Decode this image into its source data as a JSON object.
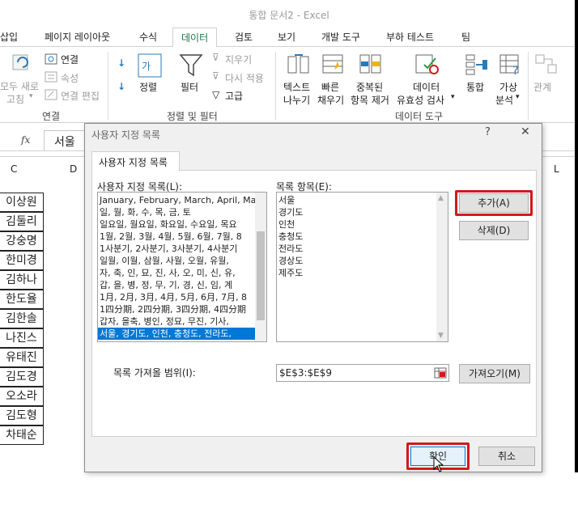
{
  "window": {
    "title": "통합 문서2 - Excel"
  },
  "tabs": [
    "삽입",
    "페이지 레이아웃",
    "수식",
    "데이터",
    "검토",
    "보기",
    "개발 도구",
    "부하 테스트",
    "팀"
  ],
  "ribbon": {
    "conn_refresh_1": "모두 새로",
    "conn_refresh_2": "고침",
    "conn_connect": "연결",
    "conn_props": "속성",
    "conn_edit": "연결 편집",
    "group_connections": "연결",
    "sort_label": "정렬",
    "filter_label": "필터",
    "clear": "지우기",
    "reapply": "다시 적용",
    "advanced": "고급",
    "group_sortfilter": "정렬 및 필터",
    "text_to_col_1": "텍스트",
    "text_to_col_2": "나누기",
    "flash_1": "빠른",
    "flash_2": "채우기",
    "remove_dup_1": "중복된",
    "remove_dup_2": "항목 제거",
    "validate_1": "데이터",
    "validate_2": "유효성 검사",
    "consolidate": "통합",
    "whatif_1": "가상",
    "whatif_2": "분석",
    "relations": "관계",
    "group_datatools": "데이터 도구"
  },
  "formula_bar": {
    "fx": "fx",
    "value": "서울"
  },
  "columns": {
    "c": "C",
    "d": "D",
    "l": "L"
  },
  "cells": [
    "이상원",
    "김둘리",
    "강숭명",
    "한미경",
    "김하나",
    "한도율",
    "김한솔",
    "나진스",
    "유태진",
    "김도경",
    "오소라",
    "김도형",
    "차태순"
  ],
  "dialog": {
    "title": "사용자 지정 목록",
    "help": "?",
    "close": "✕",
    "tab": "사용자 지정 목록",
    "lists_label": "사용자 지정 목록(L):",
    "entries_label": "목록 항목(E):",
    "lists": [
      "January, February, March, April, Ma",
      "일, 월, 화, 수, 목, 금, 토",
      "일요일, 월요일, 화요일, 수요일, 목요",
      "1월, 2월, 3월, 4월, 5월, 6월, 7월, 8",
      "1사분기, 2사분기, 3사분기, 4사분기",
      "일월, 이월, 삼월, 사월, 오월, 유월, ",
      "자, 축, 인, 묘, 진, 사, 오, 미, 신, 유,",
      "갑, 을, 병, 정, 무, 기, 경, 신, 임, 계",
      "1月, 2月, 3月, 4月, 5月, 6月, 7月, 8",
      "1四分期, 2四分期, 3四分期, 4四分期",
      "갑자, 을축, 병인, 정묘, 무진, 기사, ",
      "서울, 경기도, 인천, 충청도, 전라도,"
    ],
    "entries": [
      "서울",
      "경기도",
      "인천",
      "충청도",
      "전라도",
      "경상도",
      "제주도"
    ],
    "add": "추가(A)",
    "delete": "삭제(D)",
    "import_label": "목록 가져올 범위(I):",
    "import_range": "$E$3:$E$9",
    "import_button": "가져오기(M)",
    "ok": "확인",
    "cancel": "취소"
  }
}
